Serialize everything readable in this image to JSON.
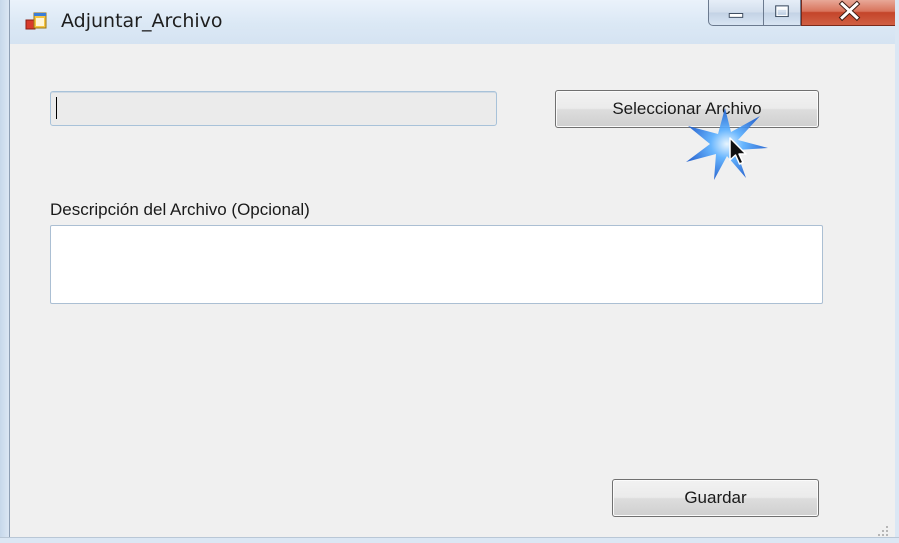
{
  "window": {
    "title": "Adjuntar_Archivo",
    "icon": "windows-form-icon",
    "caption_buttons": [
      "minimize-icon",
      "maximize-icon",
      "close-icon"
    ]
  },
  "form": {
    "file_path": {
      "value": "",
      "placeholder": ""
    },
    "select_button_label": "Seleccionar Archivo",
    "description_label": "Descripción del Archivo (Opcional)",
    "description_value": "",
    "save_button_label": "Guardar"
  },
  "colors": {
    "titlebar": "#dbe8f5",
    "client_background": "#f0f0f0",
    "close_button": "#c4452a",
    "click_highlight": "#3a8fe6"
  }
}
